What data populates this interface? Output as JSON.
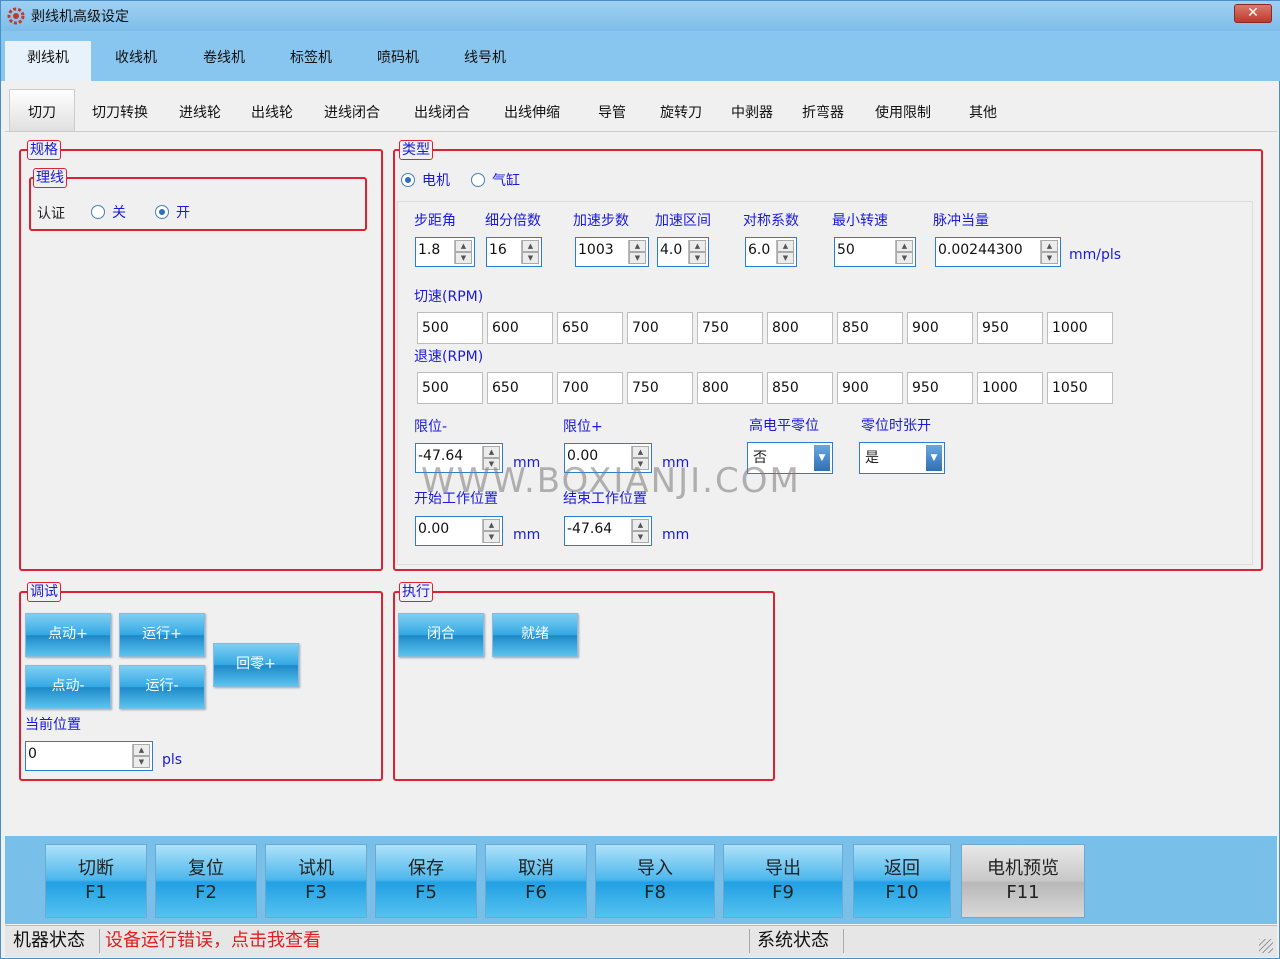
{
  "window": {
    "title": "剥线机高级设定",
    "close_label": "✕"
  },
  "tabs_main": [
    {
      "label": "剥线机",
      "active": true
    },
    {
      "label": "收线机"
    },
    {
      "label": "卷线机"
    },
    {
      "label": "标签机"
    },
    {
      "label": "喷码机"
    },
    {
      "label": "线号机"
    }
  ],
  "tabs_sub": [
    {
      "label": "切刀",
      "active": true
    },
    {
      "label": "切刀转换"
    },
    {
      "label": "进线轮"
    },
    {
      "label": "出线轮"
    },
    {
      "label": "进线闭合"
    },
    {
      "label": "出线闭合"
    },
    {
      "label": "出线伸缩"
    },
    {
      "label": "导管"
    },
    {
      "label": "旋转刀"
    },
    {
      "label": "中剥器"
    },
    {
      "label": "折弯器"
    },
    {
      "label": "使用限制"
    },
    {
      "label": "其他"
    }
  ],
  "spec": {
    "legend": "规格",
    "sub_legend": "理线",
    "auth_label": "认证",
    "options": [
      "关",
      "开"
    ],
    "selected": "开"
  },
  "type": {
    "legend": "类型",
    "options": [
      "电机",
      "气缸"
    ],
    "selected": "电机",
    "params": [
      {
        "label": "步距角",
        "value": "1.8"
      },
      {
        "label": "细分倍数",
        "value": "16"
      },
      {
        "label": "加速步数",
        "value": "1003"
      },
      {
        "label": "加速区间",
        "value": "4.0"
      },
      {
        "label": "对称系数",
        "value": "6.0"
      },
      {
        "label": "最小转速",
        "value": "50"
      },
      {
        "label": "脉冲当量",
        "value": "0.00244300"
      }
    ],
    "pulse_unit": "mm/pls",
    "cut_speed_label": "切速(RPM)",
    "cut_speeds": [
      "500",
      "600",
      "650",
      "700",
      "750",
      "800",
      "850",
      "900",
      "950",
      "1000"
    ],
    "return_speed_label": "退速(RPM)",
    "return_speeds": [
      "500",
      "650",
      "700",
      "750",
      "800",
      "850",
      "900",
      "950",
      "1000",
      "1050"
    ],
    "limit_minus_label": "限位-",
    "limit_minus": "-47.64",
    "limit_plus_label": "限位+",
    "limit_plus": "0.00",
    "unit_mm": "mm",
    "high_level_zero_label": "高电平零位",
    "high_level_zero": "否",
    "zero_open_label": "零位时张开",
    "zero_open": "是",
    "start_pos_label": "开始工作位置",
    "start_pos": "0.00",
    "end_pos_label": "结束工作位置",
    "end_pos": "-47.64"
  },
  "debug": {
    "legend": "调试",
    "jog_plus": "点动+",
    "run_plus": "运行+",
    "home_plus": "回零+",
    "jog_minus": "点动-",
    "run_minus": "运行-",
    "pos_label": "当前位置",
    "pos_value": "0",
    "pos_unit": "pls"
  },
  "exec": {
    "legend": "执行",
    "close_btn": "闭合",
    "ready_btn": "就绪"
  },
  "fkeys": [
    {
      "label": "切断",
      "key": "F1"
    },
    {
      "label": "复位",
      "key": "F2"
    },
    {
      "label": "试机",
      "key": "F3"
    },
    {
      "label": "保存",
      "key": "F5"
    },
    {
      "label": "取消",
      "key": "F6"
    },
    {
      "label": "导入",
      "key": "F8"
    },
    {
      "label": "导出",
      "key": "F9"
    },
    {
      "label": "返回",
      "key": "F10"
    },
    {
      "label": "电机预览",
      "key": "F11"
    }
  ],
  "status": {
    "machine_label": "机器状态",
    "machine_msg": "设备运行错误，点击我查看",
    "system_label": "系统状态"
  },
  "watermark": "WWW.BOXIANJI.COM",
  "colors": {
    "group_border": "#dd2233",
    "label_blue": "#1a1adb",
    "error_red": "#e02020"
  }
}
